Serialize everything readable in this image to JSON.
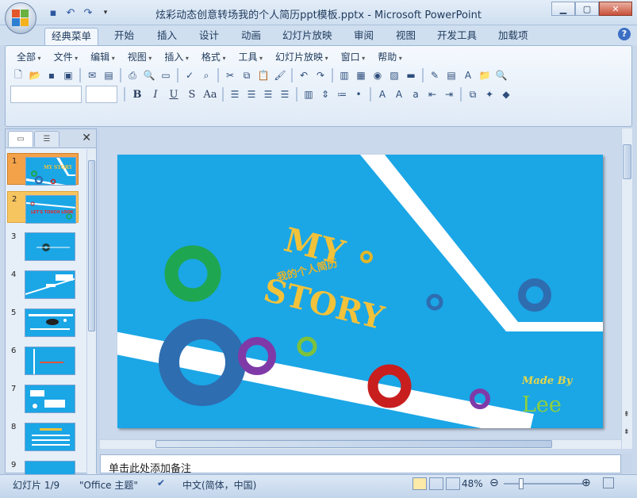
{
  "window": {
    "title": "炫彩动态创意转场我的个人简历ppt模板.pptx - Microsoft PowerPoint"
  },
  "qat": [
    {
      "icon": "save-icon"
    },
    {
      "icon": "undo-icon"
    },
    {
      "icon": "redo-icon"
    },
    {
      "icon": "customize-icon"
    }
  ],
  "ribbon_tabs": [
    "经典菜单",
    "开始",
    "插入",
    "设计",
    "动画",
    "幻灯片放映",
    "审阅",
    "视图",
    "开发工具",
    "加载项"
  ],
  "active_tab": "经典菜单",
  "classic_menu": [
    "全部",
    "文件",
    "编辑",
    "视图",
    "插入",
    "格式",
    "工具",
    "幻灯片放映",
    "窗口",
    "帮助"
  ],
  "format_buttons": [
    "B",
    "I",
    "U",
    "S",
    "Aa"
  ],
  "slide_panel": {
    "tabs": [
      {
        "icon": "slides-tab-icon"
      },
      {
        "icon": "outline-tab-icon"
      }
    ],
    "thumbnails": [
      {
        "number": "1",
        "label": "MY STORY"
      },
      {
        "number": "2",
        "label": "LET'S TOUCH LOOK"
      },
      {
        "number": "3",
        "label": ""
      },
      {
        "number": "4",
        "label": ""
      },
      {
        "number": "5",
        "label": ""
      },
      {
        "number": "6",
        "label": ""
      },
      {
        "number": "7",
        "label": ""
      },
      {
        "number": "8",
        "label": ""
      },
      {
        "number": "9",
        "label": ""
      }
    ]
  },
  "slide": {
    "title_line1": "MY",
    "subtitle": "我的个人简历",
    "title_line2": "STORY",
    "made_by": "Made By",
    "author": "Lee",
    "colors": {
      "background": "#1ba6e6",
      "title": "#f2c23a",
      "ring_green": "#1fa650",
      "ring_blue": "#2e6db0",
      "ring_purple": "#7f3aa8",
      "ring_red": "#c81e1e",
      "ring_lime": "#7ec13b",
      "ring_yellow": "#e0b62a"
    }
  },
  "notes": {
    "placeholder": "单击此处添加备注"
  },
  "status": {
    "slide": "幻灯片 1/9",
    "theme": "\"Office 主题\"",
    "language": "中文(简体，中国)",
    "zoom": "48%",
    "zoom_level": 0.48
  }
}
